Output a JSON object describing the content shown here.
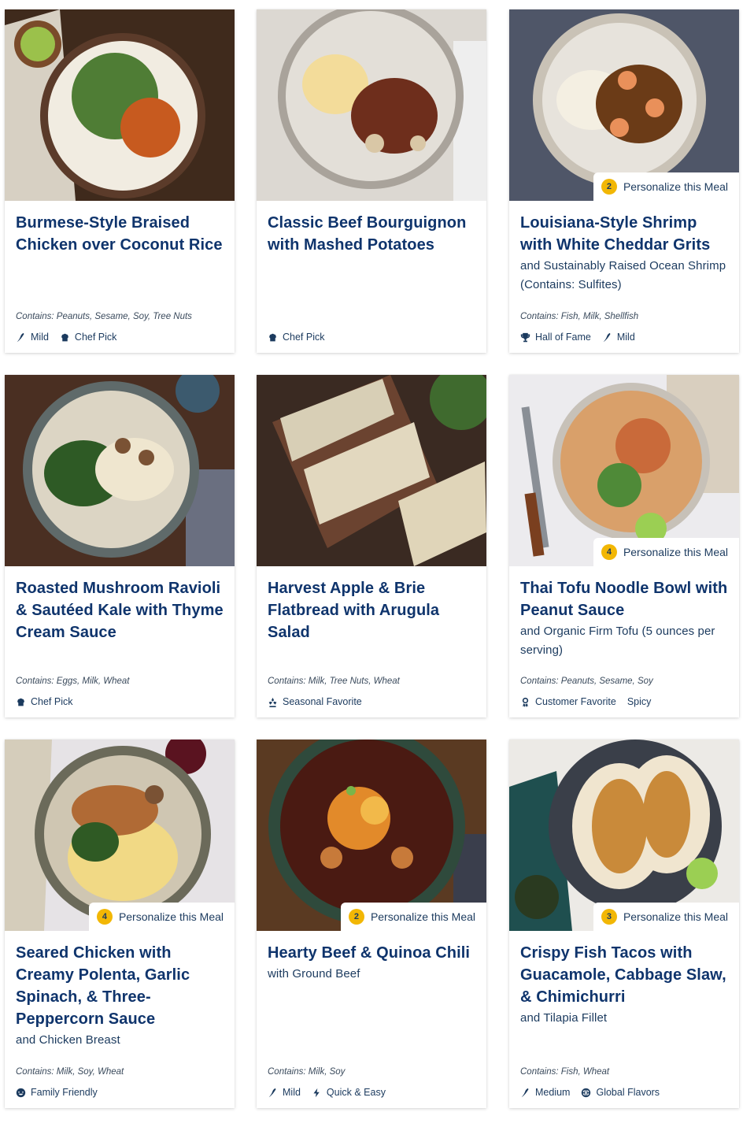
{
  "meals": [
    {
      "title": "Burmese-Style Braised Chicken over Coconut Rice",
      "subtitle": "",
      "personalize_count": "",
      "personalize_label": "",
      "contains": "Contains: Peanuts, Sesame, Soy, Tree Nuts",
      "tags": [
        {
          "label": "Mild",
          "icon": "chili-icon"
        },
        {
          "label": "Chef Pick",
          "icon": "chef-hat-icon"
        }
      ]
    },
    {
      "title": "Classic Beef Bourguignon with Mashed Potatoes",
      "subtitle": "",
      "personalize_count": "",
      "personalize_label": "",
      "contains": "",
      "tags": [
        {
          "label": "Chef Pick",
          "icon": "chef-hat-icon"
        }
      ]
    },
    {
      "title": "Louisiana-Style Shrimp with White Cheddar Grits",
      "subtitle": "and Sustainably Raised Ocean Shrimp (Contains: Sulfites)",
      "personalize_count": "2",
      "personalize_label": "Personalize this Meal",
      "contains": "Contains: Fish, Milk, Shellfish",
      "tags": [
        {
          "label": "Hall of Fame",
          "icon": "trophy-icon"
        },
        {
          "label": "Mild",
          "icon": "chili-icon"
        }
      ]
    },
    {
      "title": "Roasted Mushroom Ravioli & Sautéed Kale with Thyme Cream Sauce",
      "subtitle": "",
      "personalize_count": "",
      "personalize_label": "",
      "contains": "Contains: Eggs, Milk, Wheat",
      "tags": [
        {
          "label": "Chef Pick",
          "icon": "chef-hat-icon"
        }
      ]
    },
    {
      "title": "Harvest Apple & Brie Flatbread with Arugula Salad",
      "subtitle": "",
      "personalize_count": "",
      "personalize_label": "",
      "contains": "Contains: Milk, Tree Nuts, Wheat",
      "tags": [
        {
          "label": "Seasonal Favorite",
          "icon": "seasonal-icon"
        }
      ]
    },
    {
      "title": "Thai Tofu Noodle Bowl with Peanut Sauce",
      "subtitle": "and Organic Firm Tofu (5 ounces per serving)",
      "personalize_count": "4",
      "personalize_label": "Personalize this Meal",
      "contains": "Contains: Peanuts, Sesame, Soy",
      "tags": [
        {
          "label": "Customer Favorite",
          "icon": "ribbon-icon"
        },
        {
          "label": "Spicy",
          "icon": ""
        }
      ]
    },
    {
      "title": "Seared Chicken with Creamy Polenta, Garlic Spinach, & Three-Peppercorn Sauce",
      "subtitle": "and Chicken Breast",
      "personalize_count": "4",
      "personalize_label": "Personalize this Meal",
      "contains": "Contains: Milk, Soy, Wheat",
      "tags": [
        {
          "label": "Family Friendly",
          "icon": "smile-icon"
        }
      ]
    },
    {
      "title": "Hearty Beef & Quinoa Chili",
      "subtitle": "with Ground Beef",
      "personalize_count": "2",
      "personalize_label": "Personalize this Meal",
      "contains": "Contains: Milk, Soy",
      "tags": [
        {
          "label": "Mild",
          "icon": "chili-icon"
        },
        {
          "label": "Quick & Easy",
          "icon": "bolt-icon"
        }
      ]
    },
    {
      "title": "Crispy Fish Tacos with Guacamole, Cabbage Slaw, & Chimichurri",
      "subtitle": "and Tilapia Fillet",
      "personalize_count": "3",
      "personalize_label": "Personalize this Meal",
      "contains": "Contains: Fish, Wheat",
      "tags": [
        {
          "label": "Medium",
          "icon": "chili-icon"
        },
        {
          "label": "Global Flavors",
          "icon": "globe-icon"
        }
      ]
    }
  ],
  "colors": {
    "title": "#0f346c",
    "badge_circle": "#f2b705",
    "tag_text": "#1b3a5e"
  }
}
